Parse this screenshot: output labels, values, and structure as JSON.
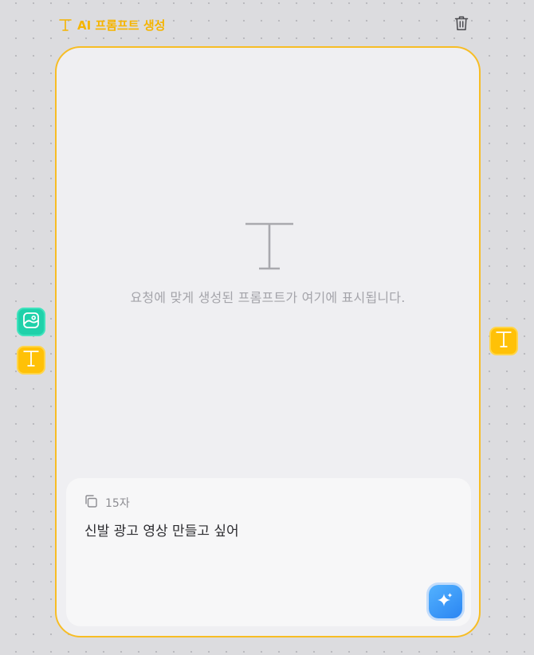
{
  "node": {
    "title": "AI 프롬프트 생성",
    "title_icon": "text-icon",
    "delete_icon": "trash-icon",
    "accent_color": "#f7bd25"
  },
  "placeholder": {
    "icon": "text-icon",
    "text": "요청에 맞게 생성된 프롬프트가 여기에 표시됩니다."
  },
  "input_panel": {
    "copy_icon": "copy-icon",
    "char_count": "15자",
    "prompt": "신발 광고 영상 만들고 싶어",
    "generate_icon": "sparkle-icon",
    "generate_color": "#2f8ff5"
  },
  "ports": {
    "left": [
      {
        "icon": "image-icon",
        "color": "#1fd1aa"
      },
      {
        "icon": "text-icon",
        "color": "#ffc107"
      }
    ],
    "right": [
      {
        "icon": "text-icon",
        "color": "#ffc107"
      }
    ]
  }
}
